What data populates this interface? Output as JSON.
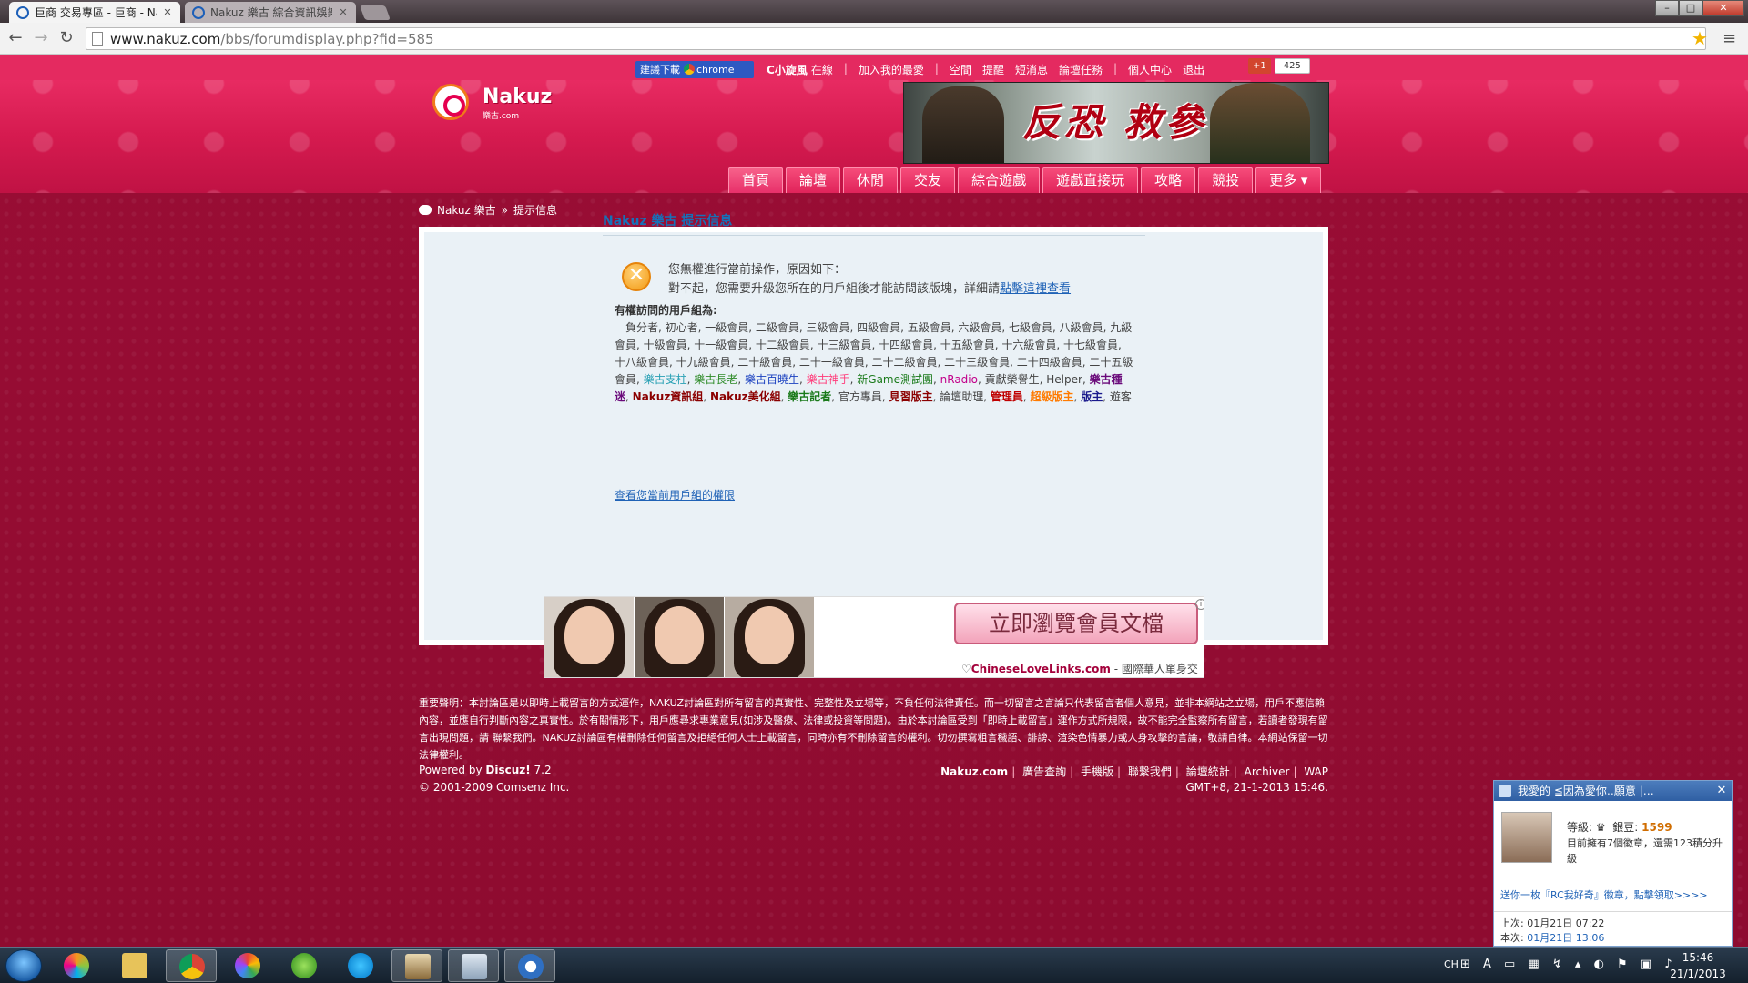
{
  "browser": {
    "tabs": [
      {
        "title": "巨商 交易專區 - 巨商 - Na",
        "active": true
      },
      {
        "title": "Nakuz 樂古 綜合資訊娛樂",
        "active": false
      }
    ],
    "url_host": "www.nakuz.com",
    "url_path": "/bbs/forumdisplay.php?fid=585"
  },
  "topbar": {
    "promo_prefix": "建議下載",
    "promo_brand": "chrome",
    "username": "C小旋風",
    "status": "在線",
    "links": [
      "加入我的最愛",
      "空間",
      "提醒",
      "短消息",
      "論壇任務",
      "個人中心",
      "退出"
    ],
    "gplus_label": "+1",
    "gplus_count": "425"
  },
  "logo": {
    "name": "Nakuz",
    "sub": "樂古.com"
  },
  "banner_ad": {
    "title": "反恐 救參"
  },
  "nav": [
    "首頁",
    "論壇",
    "休閒",
    "交友",
    "綜合遊戲",
    "遊戲直接玩",
    "攻略",
    "競投",
    "更多 ▾"
  ],
  "breadcrumb": {
    "site": "Nakuz 樂古",
    "sep": "»",
    "current": "提示信息"
  },
  "message": {
    "title": "Nakuz 樂古 提示信息",
    "line1": "您無權進行當前操作，原因如下：",
    "line2_prefix": "對不起，您需要升級您所在的用戶組後才能訪問該版塊，詳細請",
    "line2_link": "點擊這裡查看",
    "groups_label": "有權訪問的用戶組為:",
    "groups_plain": "負分者, 初心者, 一級會員, 二級會員, 三級會員, 四級會員, 五級會員, 六級會員, 七級會員, 八級會員, 九級會員, 十級會員, 十一級會員, 十二級會員, 十三級會員, 十四級會員, 十五級會員, 十六級會員, 十七級會員, 十八級會員, 十九級會員, 二十級會員, 二十一級會員, 二十二級會員, 二十三級會員, 二十四級會員, 二十五級會員, ",
    "groups_colored": [
      {
        "text": "樂古支柱",
        "cls": "g-teal"
      },
      {
        "text": "樂古長老",
        "cls": "g-green"
      },
      {
        "text": "樂古百曉生",
        "cls": "g-blue"
      },
      {
        "text": "樂古神手",
        "cls": "g-pink"
      },
      {
        "text": "新Game測試團",
        "cls": "g-dgreen"
      },
      {
        "text": "nRadio",
        "cls": "g-magenta"
      },
      {
        "text": "貢獻榮譽生",
        "cls": ""
      },
      {
        "text": "Helper",
        "cls": ""
      },
      {
        "text": "樂古種迷",
        "cls": "g-bpurple"
      },
      {
        "text": "Nakuz資訊組",
        "cls": "g-dred"
      },
      {
        "text": "Nakuz美化組",
        "cls": "g-dred"
      },
      {
        "text": "樂古記者",
        "cls": "g-bgreen"
      },
      {
        "text": "官方專員",
        "cls": ""
      },
      {
        "text": "見習版主",
        "cls": "g-dred"
      },
      {
        "text": "論壇助理",
        "cls": ""
      },
      {
        "text": "管理員",
        "cls": "g-red"
      },
      {
        "text": "超級版主",
        "cls": "g-orange"
      },
      {
        "text": "版主",
        "cls": "g-navy"
      },
      {
        "text": "遊客",
        "cls": ""
      }
    ],
    "perm_link": "查看您當前用戶組的權限"
  },
  "bottom_ad": {
    "button": "立即瀏覽會員文檔",
    "brand": "ChineseLoveLinks.com",
    "tagline": " - 國際華人單身交友",
    "info": "i"
  },
  "footer": {
    "disclaimer": "重要聲明：本討論區是以即時上載留言的方式運作，NAKUZ討論區對所有留言的真實性、完整性及立場等，不負任何法律責任。而一切留言之言論只代表留言者個人意見，並非本網站之立場，用戶不應信賴內容，並應自行判斷內容之真實性。於有關情形下，用戶應尋求專業意見(如涉及醫療、法律或投資等問題)。由於本討論區受到「即時上載留言」運作方式所規限，故不能完全監察所有留言，若讀者發現有留言出現問題，請 聯繫我們。NAKUZ討論區有權刪除任何留言及拒絕任何人士上載留言，同時亦有不刪除留言的權利。切勿撰寫粗言穢語、誹謗、渲染色情暴力或人身攻擊的言論，敬請自律。本網站保留一切法律權利。",
    "powered_prefix": "Powered by ",
    "powered_brand": "Discuz!",
    "powered_version": " 7.2",
    "copyright": "© 2001-2009 Comsenz Inc.",
    "links": [
      "Nakuz.com",
      "廣告查詢",
      "手機版",
      "聯繫我們",
      "論壇統計",
      "Archiver",
      "WAP"
    ],
    "gmt": "GMT+8, 21-1-2013 15:46."
  },
  "notification": {
    "title": "我愛的 ≦因為愛你‥願意 |…",
    "close": "✕",
    "level_label": "等級:",
    "coin_label": "銀豆:",
    "coin_value": "1599",
    "badge_info": "目前擁有7個徽章，還需123積分升級",
    "link": "送你一枚『RC我好奇』徽章，點擊領取>>>>",
    "last_label": "上次:",
    "last_value": "01月21日 07:22",
    "now_label": "本次:",
    "now_value": "01月21日 13:06"
  },
  "taskbar": {
    "lang": "CH",
    "time": "15:46",
    "date": "21/1/2013"
  },
  "icons": {
    "back": "back-arrow-icon",
    "forward": "forward-arrow-icon",
    "reload": "reload-icon",
    "star": "star-icon",
    "menu": "menu-icon"
  }
}
